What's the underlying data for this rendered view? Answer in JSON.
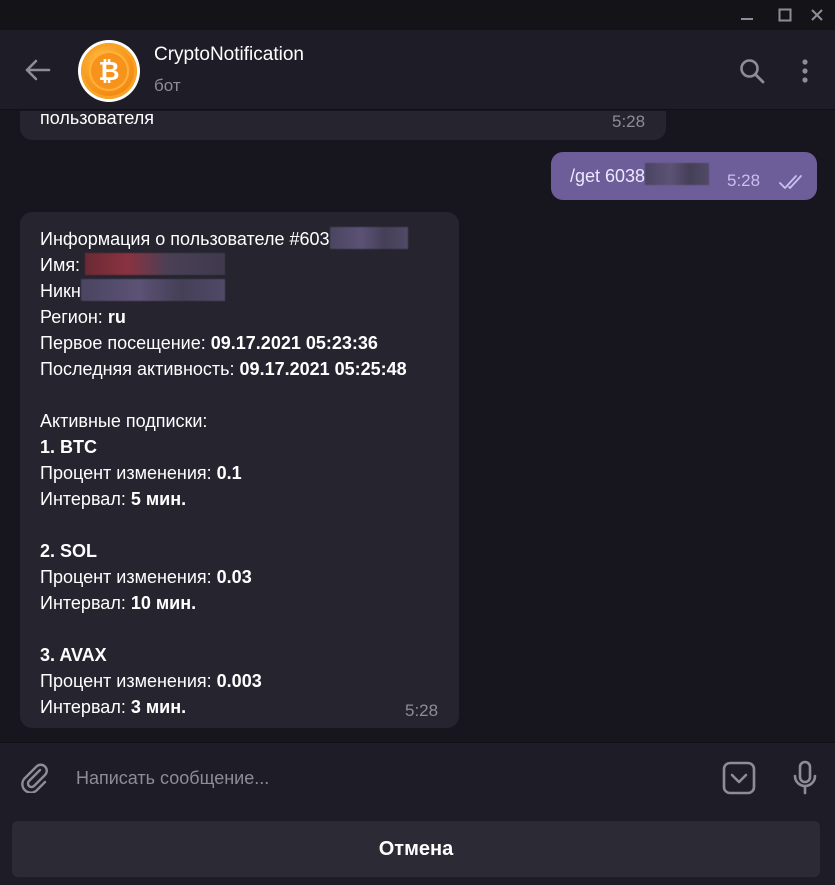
{
  "window": {
    "minimize_icon": "minimize-icon",
    "maximize_icon": "maximize-icon",
    "close_icon": "close-icon"
  },
  "header": {
    "title": "CryptoNotification",
    "subtitle": "бот",
    "avatar_symbol": "₿",
    "icons": [
      "back-arrow-icon",
      "search-icon",
      "more-vertical-icon"
    ]
  },
  "messages": {
    "prev_incoming": {
      "text": "пользователя",
      "time": "5:28"
    },
    "outgoing": {
      "text": "/get 6038",
      "time": "5:28",
      "status": "read"
    },
    "user_info": {
      "time": "5:28",
      "title_prefix": "Информация о пользователе #603",
      "name_label": "Имя:",
      "nick_label": "Никн",
      "region_label": "Регион:",
      "region_value": "ru",
      "first_visit_label": "Первое посещение:",
      "first_visit_value": "09.17.2021 05:23:36",
      "last_active_label": "Последняя активность:",
      "last_active_value": "09.17.2021 05:25:48",
      "subs_header": "Активные подписки:",
      "subscriptions": [
        {
          "title": "1. BTC",
          "pct_label": "Процент изменения:",
          "pct_value": "0.1",
          "int_label": "Интервал:",
          "int_value": "5 мин."
        },
        {
          "title": "2. SOL",
          "pct_label": "Процент изменения:",
          "pct_value": "0.03",
          "int_label": "Интервал:",
          "int_value": "10 мин."
        },
        {
          "title": "3. AVAX",
          "pct_label": "Процент изменения:",
          "pct_value": "0.003",
          "int_label": "Интервал:",
          "int_value": "3 мин."
        }
      ]
    }
  },
  "composer": {
    "placeholder": "Написать сообщение...",
    "value": ""
  },
  "cancel_button": {
    "label": "Отмена"
  },
  "colors": {
    "background": "#17161f",
    "header": "#1e1c26",
    "incoming_bubble": "#26242f",
    "outgoing_bubble": "#6d5d99",
    "muted_text": "#8f8c99"
  }
}
